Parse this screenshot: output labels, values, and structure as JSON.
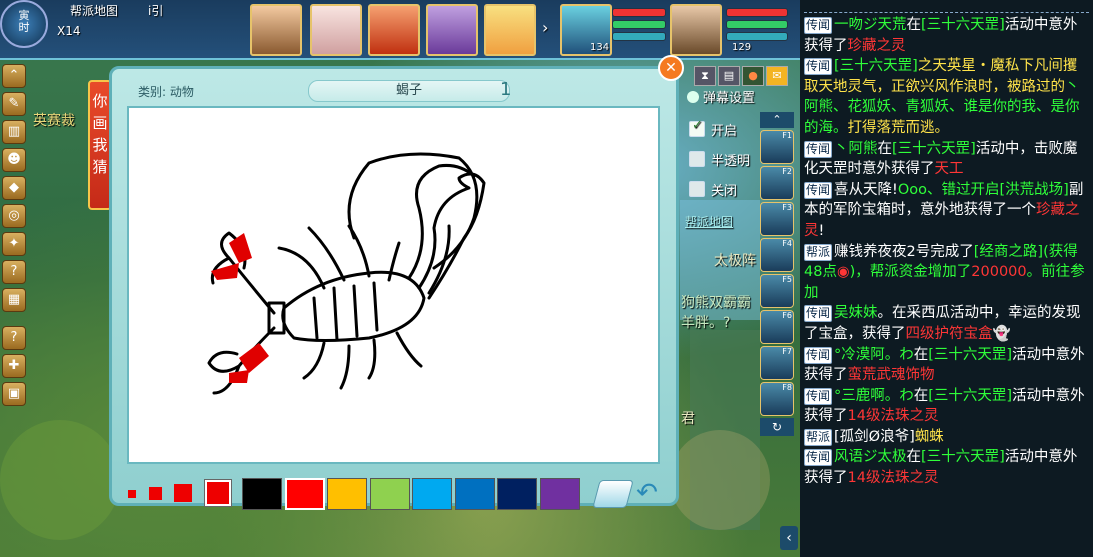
{
  "topbar": {
    "clock": "寅\n时",
    "guild_map": "帮派地图",
    "level_marker": "X14",
    "i_label": "i引",
    "portrait_levels": [
      "134",
      "129"
    ]
  },
  "game_scene": {
    "npc_texts": [
      "英赛裁",
      "太极阵",
      "狗熊双霸霸",
      "羊胖。?",
      "君"
    ],
    "guild_map_link": "帮派地图"
  },
  "left_tab": "你画我猜",
  "panel": {
    "category_label": "类别: 动物",
    "word": "蝎子",
    "count": "1"
  },
  "options": {
    "danmu_label": "弹幕设置",
    "items": [
      {
        "label": "开启",
        "checked": true
      },
      {
        "label": "半透明",
        "checked": false
      },
      {
        "label": "关闭",
        "checked": false
      }
    ]
  },
  "skill_keys": [
    "F1",
    "F2",
    "F3",
    "F4",
    "F5",
    "F6",
    "F7",
    "F8"
  ],
  "palette": {
    "brush_sizes": [
      "small",
      "medium",
      "large",
      "xlarge"
    ],
    "colors": [
      "#000000",
      "#ff0000",
      "#ffbf00",
      "#8fd14f",
      "#00a9f0",
      "#0070c0",
      "#002060",
      "#7030a0"
    ],
    "selected_color_index": 1
  },
  "chat": {
    "messages": [
      [
        {
          "t": "传闻",
          "c": "ch"
        },
        {
          "t": "一吻ジ天荒",
          "c": "g"
        },
        {
          "t": "在",
          "c": "w"
        },
        {
          "t": "[三十六天罡]",
          "c": "g"
        },
        {
          "t": "活动中意外获得了",
          "c": "w"
        },
        {
          "t": "珍藏之灵",
          "c": "r"
        }
      ],
      [
        {
          "t": "传闻",
          "c": "ch"
        },
        {
          "t": "[三十六天罡]",
          "c": "g"
        },
        {
          "t": "之天英星・魔私下凡间攫取天地灵气，正欲兴风作浪时，被路过的",
          "c": "y"
        },
        {
          "t": "丶阿熊、花狐妖、青狐妖、谁是你的我、是你的海。",
          "c": "g"
        },
        {
          "t": "打得落荒而逃。",
          "c": "y"
        }
      ],
      [
        {
          "t": "传闻",
          "c": "ch"
        },
        {
          "t": "丶阿熊",
          "c": "g"
        },
        {
          "t": "在",
          "c": "w"
        },
        {
          "t": "[三十六天罡]",
          "c": "g"
        },
        {
          "t": "活动中，击败魔化天罡时意外获得了",
          "c": "w"
        },
        {
          "t": "天工",
          "c": "r"
        }
      ],
      [
        {
          "t": "传闻",
          "c": "ch"
        },
        {
          "t": "喜从天降!",
          "c": "w"
        },
        {
          "t": "Ooo、错过开启",
          "c": "g"
        },
        {
          "t": "[洪荒战场]",
          "c": "g"
        },
        {
          "t": "副本的军阶宝箱时，意外地获得了一个",
          "c": "w"
        },
        {
          "t": "珍藏之灵",
          "c": "r"
        },
        {
          "t": "!",
          "c": "w"
        }
      ],
      [
        {
          "t": "帮派",
          "c": "ch"
        },
        {
          "t": "赚钱养夜夜2号完成了",
          "c": "w"
        },
        {
          "t": "[经商之路]",
          "c": "g"
        },
        {
          "t": "(获得48点",
          "c": "g"
        },
        {
          "t": "◉",
          "c": "r"
        },
        {
          "t": ")，",
          "c": "g"
        },
        {
          "t": "帮派资金增加了",
          "c": "g"
        },
        {
          "t": "200000",
          "c": "r"
        },
        {
          "t": "。前往参加",
          "c": "g"
        }
      ],
      [
        {
          "t": "传闻",
          "c": "ch"
        },
        {
          "t": "吴妹妹",
          "c": "g"
        },
        {
          "t": "。在采西瓜活动中，幸运的发现了宝盒，获得了",
          "c": "w"
        },
        {
          "t": "四级护符宝盒",
          "c": "r"
        },
        {
          "t": "👻",
          "c": "w"
        }
      ],
      [
        {
          "t": "传闻",
          "c": "ch"
        },
        {
          "t": "°冷漠阿。わ",
          "c": "g"
        },
        {
          "t": "在",
          "c": "w"
        },
        {
          "t": "[三十六天罡]",
          "c": "g"
        },
        {
          "t": "活动中意外获得了",
          "c": "w"
        },
        {
          "t": "蛮荒武魂饰物",
          "c": "r"
        }
      ],
      [
        {
          "t": "传闻",
          "c": "ch"
        },
        {
          "t": "°三鹿啊。わ",
          "c": "g"
        },
        {
          "t": "在",
          "c": "w"
        },
        {
          "t": "[三十六天罡]",
          "c": "g"
        },
        {
          "t": "活动中意外获得了",
          "c": "w"
        },
        {
          "t": "14级法珠之灵",
          "c": "r"
        }
      ],
      [
        {
          "t": "帮派",
          "c": "ch"
        },
        {
          "t": "[孤剑Ø浪爷]",
          "c": "w"
        },
        {
          "t": "蜘蛛",
          "c": "y"
        }
      ],
      [
        {
          "t": "传闻",
          "c": "ch"
        },
        {
          "t": "风语ジ太极",
          "c": "g"
        },
        {
          "t": "在",
          "c": "w"
        },
        {
          "t": "[三十六天罡]",
          "c": "g"
        },
        {
          "t": "活动中意外获得了",
          "c": "w"
        },
        {
          "t": "14级法珠之灵",
          "c": "r"
        }
      ]
    ]
  }
}
